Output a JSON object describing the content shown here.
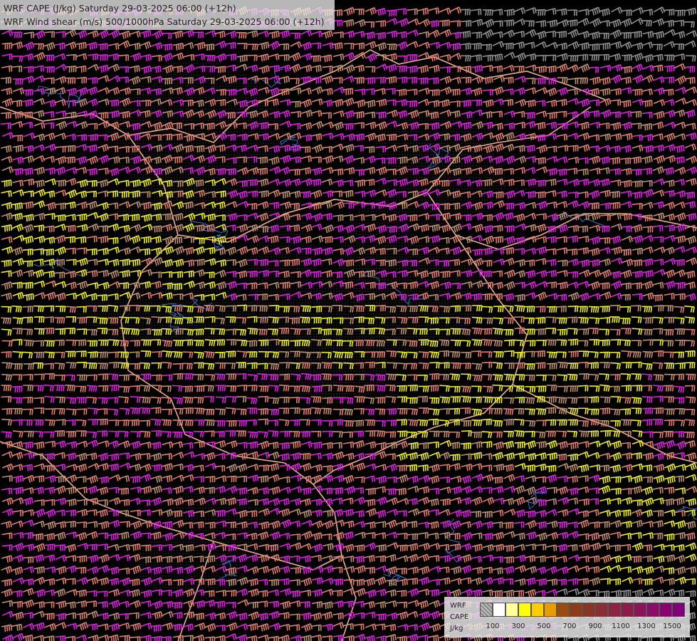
{
  "titles": {
    "line1": "WRF CAPE (J/kg) Saturday 29-03-2025 06:00 (+12h)",
    "line2": "WRF Wind shear (m/s) 500/1000hPa Saturday 29-03-2025 06:00 (+12h)"
  },
  "legend": {
    "label_line1": "WRF",
    "label_line2": "CAPE",
    "label_line3": "J/kg",
    "swatch_colors": [
      "hatch",
      "#ffffff",
      "#ffff99",
      "#ffff00",
      "#ffcc00",
      "#e89c00",
      "#9c4a10",
      "#8c3c18",
      "#8a3424",
      "#8c2c34",
      "#8c2440",
      "#8c1c48",
      "#8a1458",
      "#8a0c66",
      "#880470",
      "#80007a"
    ],
    "ticks": [
      "100",
      "300",
      "500",
      "700",
      "900",
      "1100",
      "1300",
      "1500"
    ]
  },
  "colors": {
    "background": "#000000",
    "barb_magenta": "#e020e0",
    "barb_salmon": "#e08070",
    "barb_tan": "#c09070",
    "barb_yellow": "#f0f020",
    "barb_gray": "#909090",
    "borders": "#e8b090",
    "rivers": "#4070c0",
    "title_bg": "#ebebeb"
  },
  "icons": {
    "wind_barb": "wind-barb-icon"
  }
}
